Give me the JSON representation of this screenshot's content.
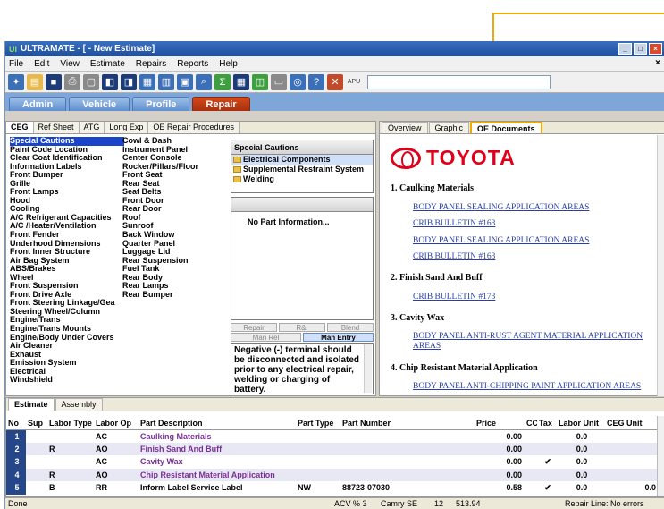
{
  "window": {
    "title": "ULTRAMATE - [ - New Estimate]",
    "logo": "UI"
  },
  "window_controls": {
    "minimize": "_",
    "maximize": "□",
    "close": "×",
    "mdi_close": "×"
  },
  "menu": [
    "File",
    "Edit",
    "View",
    "Estimate",
    "Repairs",
    "Reports",
    "Help"
  ],
  "toolbar": {
    "apu_label": "APU",
    "search_value": ""
  },
  "main_tabs": [
    "Admin",
    "Vehicle",
    "Profile",
    "Repair"
  ],
  "left_tabs": [
    "CEG",
    "Ref Sheet",
    "ATG",
    "Long Exp",
    "OE Repair Procedures"
  ],
  "categories_col1": [
    "Special Cautions",
    "Paint Code Location",
    "Clear Coat Identification",
    "Information Labels",
    "Front Bumper",
    "Grille",
    "Front Lamps",
    "Hood",
    "Cooling",
    "A/C Refrigerant Capacities",
    "A/C /Heater/Ventilation",
    "Front Fender",
    "Underhood Dimensions",
    "Front Inner Structure",
    "Air Bag System",
    "ABS/Brakes",
    "Wheel",
    "Front Suspension",
    "Front Drive Axle",
    "Front Steering Linkage/Gea",
    "Steering Wheel/Column",
    "Engine/Trans",
    "Engine/Trans Mounts",
    "Engine/Body Under Covers",
    "Air Cleaner",
    "Exhaust",
    "Emission System",
    "Electrical",
    "Windshield"
  ],
  "categories_col2": [
    "Cowl & Dash",
    "Instrument Panel",
    "Center Console",
    "Rocker/Pillars/Floor",
    "Front Seat",
    "Rear Seat",
    "Seat Belts",
    "Front Door",
    "Rear Door",
    "Roof",
    "Sunroof",
    "Back Window",
    "Quarter Panel",
    "Luggage Lid",
    "Rear Suspension",
    "Fuel Tank",
    "Rear Body",
    "Rear Lamps",
    "Rear Bumper"
  ],
  "special_cautions": {
    "title": "Special Cautions",
    "items": [
      "Electrical Components",
      "Supplemental Restraint System",
      "Welding"
    ]
  },
  "part_info": {
    "text": "No Part Information..."
  },
  "action_buttons": {
    "repair": "Repair",
    "ri": "R&I",
    "blend": "Blend",
    "man_rel": "Man Rel",
    "man_entry": "Man Entry"
  },
  "note": "Negative (-) terminal should be disconnected and isolated prior to any electrical repair, welding or charging of battery.",
  "right_tabs": [
    "Overview",
    "Graphic",
    "OE Documents"
  ],
  "doc": {
    "brand": "TOYOTA",
    "sections": [
      {
        "title": "1.   Caulking Materials",
        "links": [
          "BODY PANEL SEALING APPLICATION AREAS",
          "CRIB BULLETIN #163",
          "BODY PANEL SEALING APPLICATION AREAS",
          "CRIB BULLETIN #163"
        ]
      },
      {
        "title": "2.   Finish Sand And Buff",
        "links": [
          "CRIB BULLETIN #173"
        ]
      },
      {
        "title": "3.   Cavity Wax",
        "links": [
          "BODY PANEL ANTI-RUST AGENT MATERIAL APPLICATION",
          "AREAS"
        ]
      },
      {
        "title": "4.   Chip Resistant Material Application",
        "links": [
          "BODY PANEL ANTI-CHIPPING PAINT APPLICATION AREAS"
        ]
      }
    ]
  },
  "bottom_tabs": [
    "Estimate",
    "Assembly"
  ],
  "grid": {
    "headers": [
      "No",
      "Sup",
      "Labor Type",
      "Labor Op",
      "Part Description",
      "Part Type",
      "Part Number",
      "Price",
      "CC",
      "Tax",
      "Labor Unit",
      "CEG Unit"
    ],
    "rows": [
      [
        "1",
        "",
        "",
        "AC",
        "Caulking Materials",
        "",
        "",
        "0.00",
        "",
        "",
        "0.0",
        ""
      ],
      [
        "2",
        "",
        "R",
        "AO",
        "Finish Sand And Buff",
        "",
        "",
        "0.00",
        "",
        "",
        "0.0",
        ""
      ],
      [
        "3",
        "",
        "",
        "AC",
        "Cavity Wax",
        "",
        "",
        "0.00",
        "",
        "✔",
        "0.0",
        ""
      ],
      [
        "4",
        "",
        "R",
        "AO",
        "Chip Resistant Material Application",
        "",
        "",
        "0.00",
        "",
        "",
        "0.0",
        ""
      ],
      [
        "5",
        "",
        "B",
        "RR",
        "Inform Label Service Label",
        "NW",
        "88723-07030",
        "0.58",
        "",
        "✔",
        "0.0",
        "0.0"
      ]
    ]
  },
  "status": {
    "left": "Done",
    "acv": "ACV % 3",
    "model": "Camry SE",
    "num": "12",
    "total": "513.94",
    "repair_line": "Repair Line: No errors"
  },
  "colors": {
    "accent": "#f2a900",
    "active_tab": "#c0400f",
    "link": "#2a3fa8",
    "brand": "#e0001a"
  }
}
